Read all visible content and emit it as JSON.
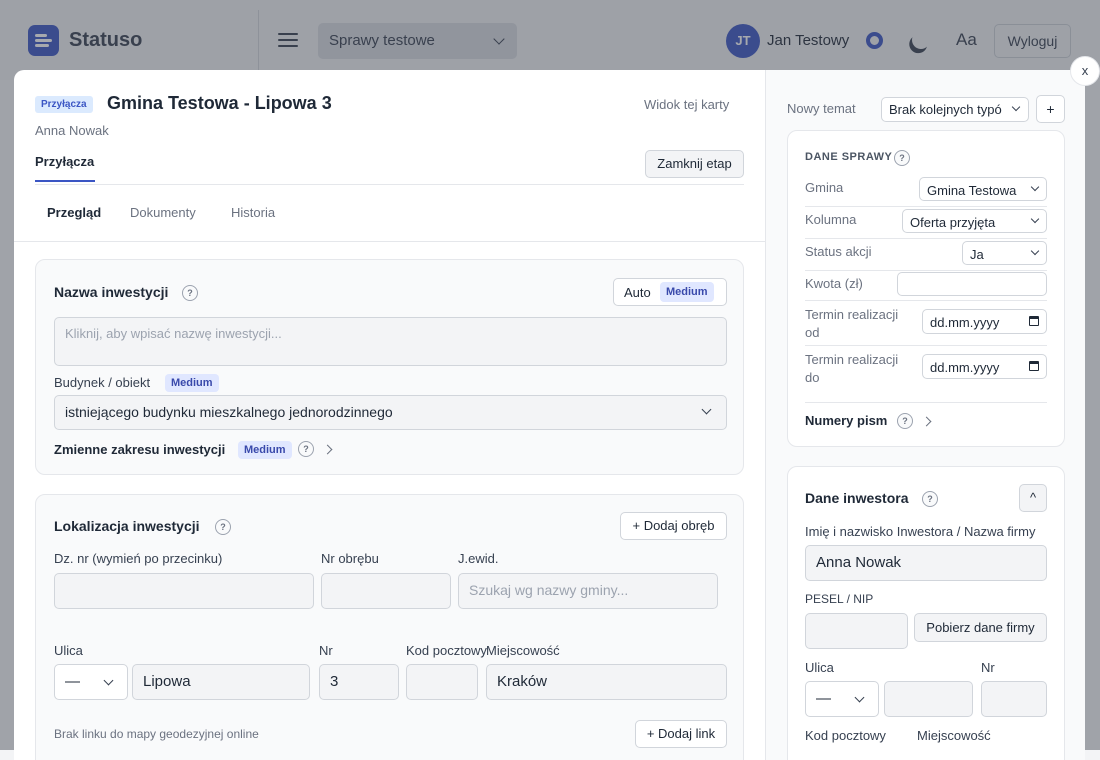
{
  "topbar": {
    "app_name": "Statuso",
    "case_select": "Sprawy testowe",
    "avatar_initials": "JT",
    "user_name": "Jan Testowy",
    "font_toggle": "Aa",
    "logout": "Wyloguj"
  },
  "modal": {
    "close": "x",
    "type_badge": "Przyłącza",
    "title": "Gmina Testowa - Lipowa 3",
    "subtitle": "Anna Nowak",
    "view_card": "Widok tej karty",
    "stage_tab": "Przyłącza",
    "close_stage": "Zamknij etap",
    "tabs": [
      "Przegląd",
      "Dokumenty",
      "Historia"
    ]
  },
  "investment_card": {
    "title": "Nazwa inwestycji",
    "help": "?",
    "auto_label": "Auto",
    "auto_badge": "Medium",
    "name_placeholder": "Kliknij, aby wpisać nazwę inwestycji...",
    "building_label": "Budynek / obiekt",
    "building_badge": "Medium",
    "building_value": "istniejącego budynku mieszkalnego jednorodzinnego",
    "variables_label": "Zmienne zakresu inwestycji",
    "variables_badge": "Medium"
  },
  "location_card": {
    "title": "Lokalizacja inwestycji",
    "add_precinct": "+ Dodaj obręb",
    "plot_label": "Dz. nr (wymień po przecinku)",
    "precinct_label": "Nr obrębu",
    "jewid_label": "J.ewid.",
    "jewid_placeholder": "Szukaj wg nazwy gminy...",
    "street_label": "Ulica",
    "nr_label": "Nr",
    "postal_label": "Kod pocztowy",
    "city_label": "Miejscowość",
    "street_prefix": "—",
    "street_value": "Lipowa",
    "nr_value": "3",
    "city_value": "Kraków",
    "map_info": "Brak linku do mapy geodezyjnej online",
    "add_link": "+ Dodaj link"
  },
  "sidebar": {
    "new_topic_label": "Nowy temat",
    "new_topic_select": "Brak kolejnych typó",
    "plus": "+",
    "case_data": {
      "title": "DANE SPRAWY",
      "rows": [
        {
          "label": "Gmina",
          "value": "Gmina Testowa"
        },
        {
          "label": "Kolumna",
          "value": "Oferta przyjęta"
        },
        {
          "label": "Status akcji",
          "value": "Ja"
        },
        {
          "label": "Kwota (zł)",
          "value": ""
        }
      ],
      "date_from_label": "Termin realizacji od",
      "date_to_label": "Termin realizacji do",
      "date_placeholder": "dd.mm.yyyy",
      "letters": "Numery pism"
    },
    "investor": {
      "title": "Dane inwestora",
      "collapse": "^",
      "name_label": "Imię i nazwisko Inwestora / Nazwa firmy",
      "name_value": "Anna Nowak",
      "pesel_label": "PESEL / NIP",
      "fetch_button": "Pobierz dane firmy",
      "street_label": "Ulica",
      "nr_label": "Nr",
      "street_prefix": "—",
      "postal_label": "Kod pocztowy",
      "city_label": "Miejscowość"
    }
  }
}
